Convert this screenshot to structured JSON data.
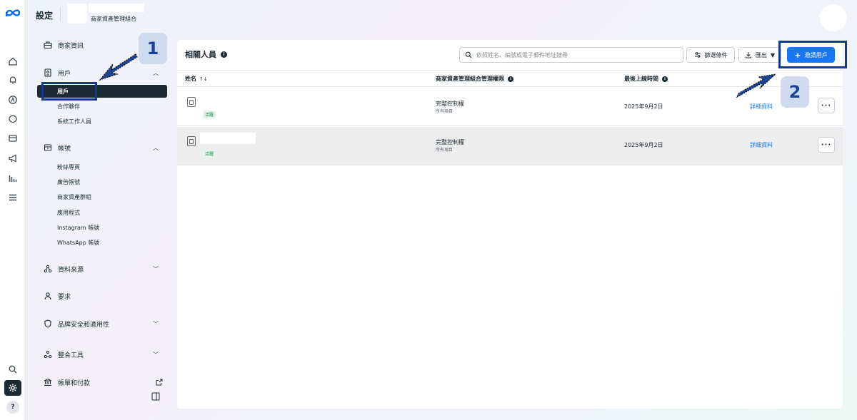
{
  "header": {
    "title": "設定",
    "business_manager": "商家資產管理組合"
  },
  "sidebar": {
    "business_info": "商家資訊",
    "users": {
      "label": "用戶",
      "items": [
        "用戶",
        "合作夥伴",
        "系統工作人員"
      ]
    },
    "accounts": {
      "label": "帳號",
      "items": [
        "粉絲專頁",
        "廣告帳號",
        "商家資產群組",
        "應用程式",
        "Instagram 帳號",
        "WhatsApp 帳號"
      ]
    },
    "data_sources": "資料來源",
    "requests": "要求",
    "brand_safety": "品牌安全和適用性",
    "integrations": "整合工具",
    "billing": "帳單和付款"
  },
  "main": {
    "title": "相關人員",
    "search_placeholder": "依照姓名、編號或電子郵件地址搜尋",
    "filter_label": "篩選條件",
    "export_label": "匯出",
    "invite_label": "邀請用戶",
    "columns": {
      "name": "姓名",
      "sort_glyph": "↑↓",
      "permission": "商家資產管理組合管理權限",
      "last_active": "最後上線時間"
    },
    "rows": [
      {
        "badge": "活躍",
        "permission": "完整控制權",
        "permission_sub": "所有項目",
        "date": "2025年9月2日",
        "action": "詳細資料"
      },
      {
        "badge": "活躍",
        "permission": "完整控制權",
        "permission_sub": "所有項目",
        "date": "2025年9月2日",
        "action": "詳細資料"
      }
    ]
  },
  "annotations": {
    "step1": "1",
    "step2": "2"
  },
  "colors": {
    "accent": "#1877f2",
    "annotation": "#123a8c",
    "active_nav": "#1c2b33"
  }
}
